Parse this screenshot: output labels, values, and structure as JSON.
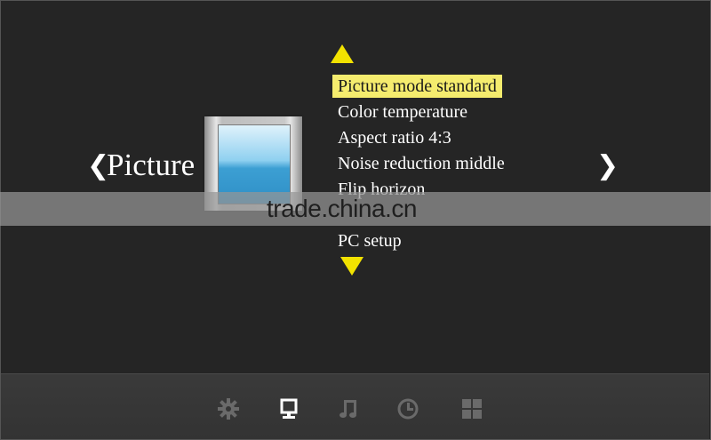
{
  "category": {
    "prev_glyph": "❮",
    "label": "Picture",
    "next_glyph": "❯",
    "icon": "picture-monitor-icon"
  },
  "menu": {
    "items": [
      {
        "label": "Picture mode standard",
        "selected": true
      },
      {
        "label": "Color temperature",
        "selected": false
      },
      {
        "label": "Aspect ratio 4:3",
        "selected": false
      },
      {
        "label": "Noise reduction middle",
        "selected": false
      },
      {
        "label": "Flip horizon",
        "selected": false
      },
      {
        "label": "",
        "selected": false
      },
      {
        "label": "PC setup",
        "selected": false
      }
    ],
    "scroll_up_icon": "triangle-up-icon",
    "scroll_down_icon": "triangle-down-icon"
  },
  "watermark": {
    "text": "trade.china.cn"
  },
  "bottom_tabs": [
    {
      "name": "settings",
      "icon": "gear-icon",
      "active": false
    },
    {
      "name": "picture",
      "icon": "monitor-icon",
      "active": true
    },
    {
      "name": "sound",
      "icon": "music-note-icon",
      "active": false
    },
    {
      "name": "time",
      "icon": "clock-icon",
      "active": false
    },
    {
      "name": "options",
      "icon": "grid-icon",
      "active": false
    }
  ],
  "colors": {
    "background": "#252525",
    "highlight": "#f5ec6e",
    "arrow": "#f2e200",
    "tab_active": "#ffffff",
    "tab_inactive": "#6a6a6a"
  }
}
